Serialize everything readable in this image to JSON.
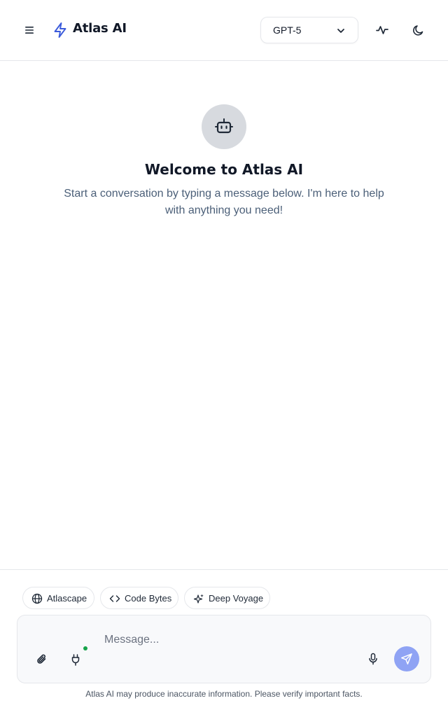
{
  "header": {
    "brand_name": "Atlas AI",
    "model_selected": "GPT-5",
    "icons": {
      "menu": "menu-icon",
      "brand": "lightning-icon",
      "chevron": "chevron-down-icon",
      "activity": "activity-icon",
      "theme": "moon-icon"
    }
  },
  "welcome": {
    "icon": "bot-icon",
    "title": "Welcome to Atlas AI",
    "subtitle": "Start a conversation by typing a message below. I'm here to help with anything you need!"
  },
  "chips": [
    {
      "label": "Atlascape",
      "icon": "globe-icon"
    },
    {
      "label": "Code Bytes",
      "icon": "code-icon"
    },
    {
      "label": "Deep Voyage",
      "icon": "sparkles-icon"
    }
  ],
  "composer": {
    "placeholder": "Message...",
    "status_color": "#16a34a",
    "send_color": "#8fa3f4"
  },
  "footer": {
    "disclaimer": "Atlas AI may produce inaccurate information. Please verify important facts."
  },
  "colors": {
    "brand_accent": "#3b5bdb",
    "text_primary": "#111827",
    "text_muted": "#4b5f78"
  }
}
